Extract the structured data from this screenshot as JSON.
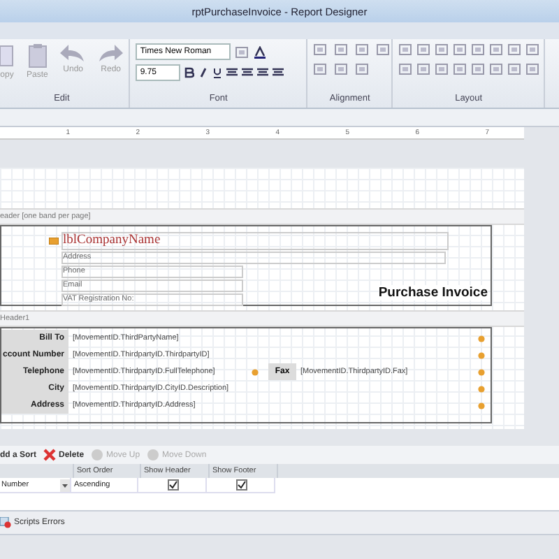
{
  "window": {
    "title": "rptPurchaseInvoice - Report Designer"
  },
  "ribbon": {
    "edit": {
      "label": "Edit",
      "buttons": [
        {
          "kind": "copy",
          "label": "opy",
          "disabled": true
        },
        {
          "kind": "paste",
          "label": "Paste",
          "disabled": true
        },
        {
          "kind": "undo",
          "label": "Undo",
          "disabled": true
        },
        {
          "kind": "redo",
          "label": "Redo",
          "disabled": true
        }
      ]
    },
    "font": {
      "label": "Font",
      "font_name": "Times New Roman",
      "font_size": "9.75"
    },
    "alignment": {
      "label": "Alignment"
    },
    "layout": {
      "label": "Layout"
    }
  },
  "ruler": {
    "numbers": [
      "1",
      "2",
      "3",
      "4",
      "5",
      "6",
      "7"
    ]
  },
  "report": {
    "page_header_band": "eader [one band per page]",
    "company_name": "lblCompanyName",
    "company_fields": [
      "Address",
      "Phone",
      "Email",
      "VAT Registration No:"
    ],
    "title": "Purchase Invoice",
    "group_header_band": "Header1",
    "rows": [
      {
        "label": "Bill To",
        "value": "[MovementID.ThirdPartyName]"
      },
      {
        "label": "ccount Number",
        "value": "[MovementID.ThirdpartyID.ThirdpartyID]"
      },
      {
        "label": "Telephone",
        "value": "[MovementID.ThirdpartyID.FullTelephone]",
        "extra_label": "Fax",
        "extra_value": "[MovementID.ThirdpartyID.Fax]"
      },
      {
        "label": "City",
        "value": "[MovementID.ThirdpartyID.CityID.Description]"
      },
      {
        "label": "Address",
        "value": "[MovementID.ThirdpartyID.Address]"
      }
    ]
  },
  "sort_panel": {
    "toolbar": [
      {
        "kind": "add",
        "label": "dd a Sort",
        "disabled": false
      },
      {
        "kind": "delete",
        "label": "Delete",
        "disabled": false
      },
      {
        "kind": "up",
        "label": "Move Up",
        "disabled": true
      },
      {
        "kind": "down",
        "label": "Move Down",
        "disabled": true
      }
    ],
    "columns": [
      "Sort Order",
      "Show Header",
      "Show Footer"
    ],
    "rows": [
      {
        "field": "Number",
        "sort_order": "Ascending",
        "show_header": true,
        "show_footer": true
      }
    ]
  },
  "errors_panel": {
    "tab": "Scripts Errors"
  }
}
